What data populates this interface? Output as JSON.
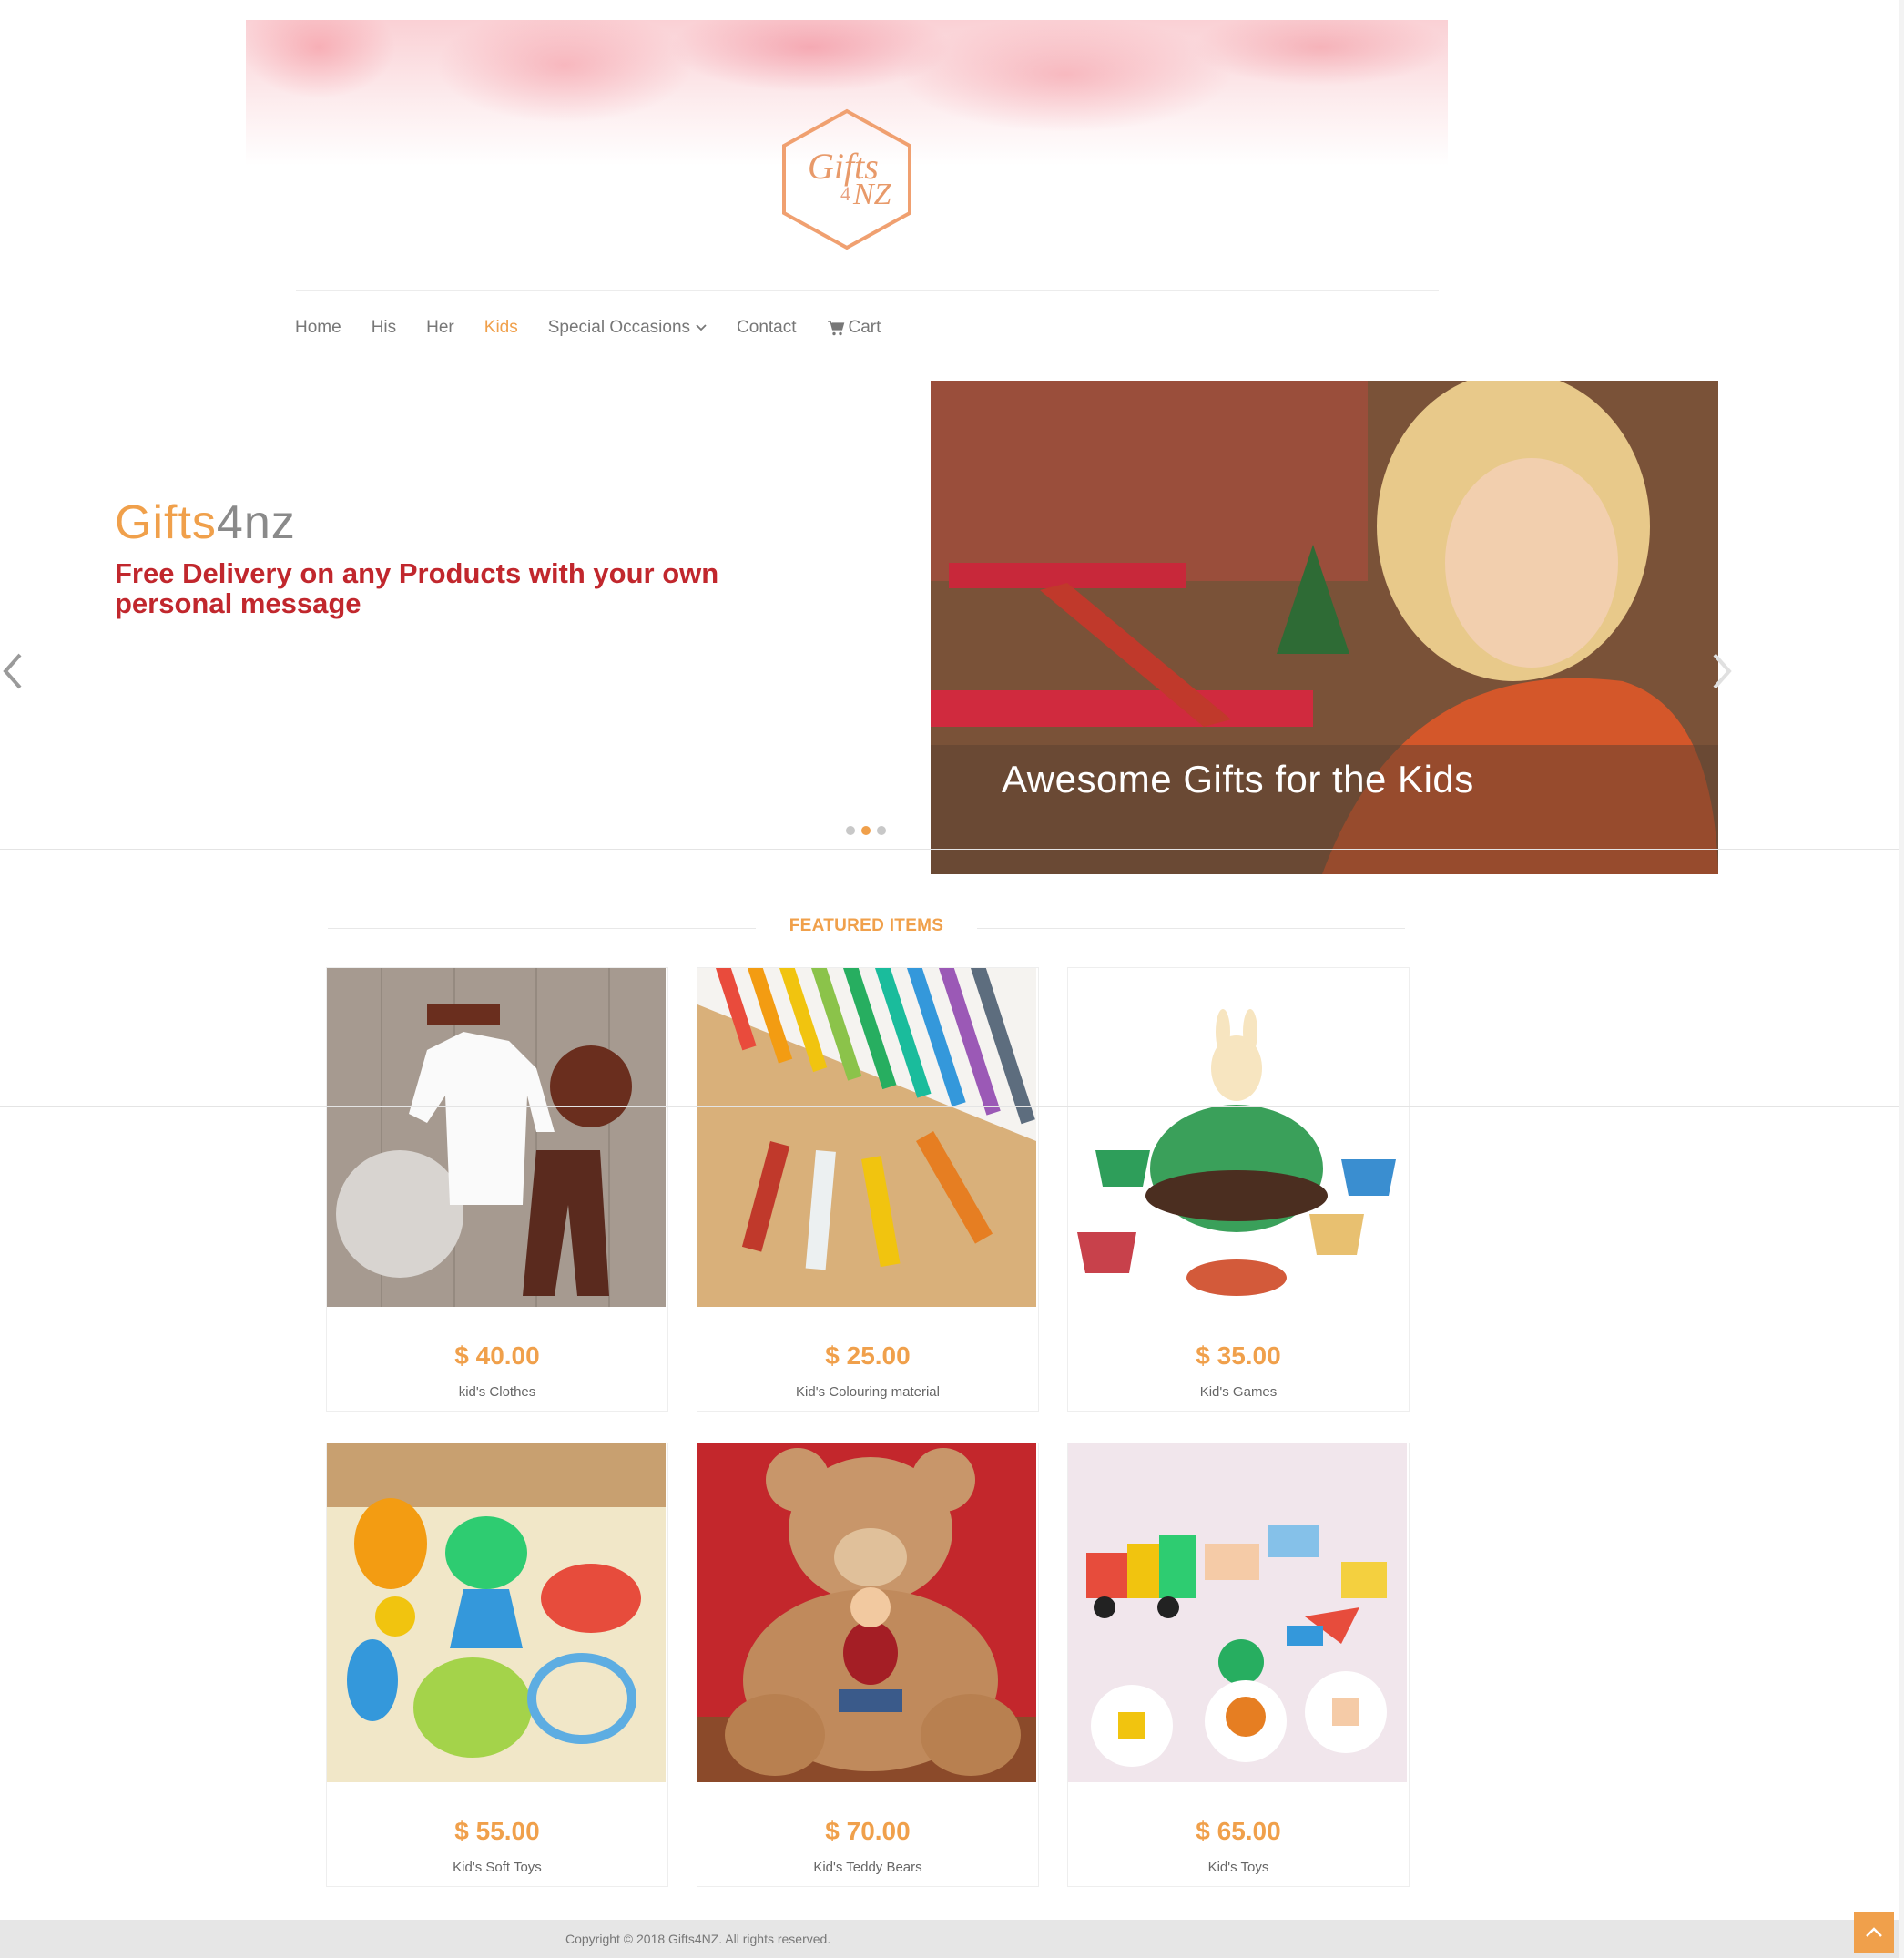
{
  "brand": {
    "logo_line1": "Gifts",
    "logo_line2": "4",
    "logo_line3": "NZ"
  },
  "nav": {
    "items": [
      {
        "label": "Home"
      },
      {
        "label": "His"
      },
      {
        "label": "Her"
      },
      {
        "label": "Kids",
        "active": true
      },
      {
        "label": "Special Occasions",
        "icon": "chevron-down-icon"
      },
      {
        "label": "Contact"
      },
      {
        "label": "Cart",
        "icon": "shopping-cart-icon"
      }
    ]
  },
  "hero": {
    "brand_part1": "Gifts",
    "brand_part2": "4nz",
    "message": "Free Delivery on any Products with your own personal message",
    "caption": "Awesome Gifts for the Kids",
    "slides_total": 3,
    "active_slide": 2
  },
  "featured": {
    "title": "FEATURED ITEMS",
    "items": [
      {
        "price": "$ 40.00",
        "name": "kid's Clothes"
      },
      {
        "price": "$ 25.00",
        "name": "Kid's Colouring material"
      },
      {
        "price": "$ 35.00",
        "name": "Kid's Games"
      },
      {
        "price": "$ 55.00",
        "name": "Kid's Soft Toys"
      },
      {
        "price": "$ 70.00",
        "name": "Kid's Teddy Bears"
      },
      {
        "price": "$ 65.00",
        "name": "Kid's Toys"
      }
    ]
  },
  "footer": {
    "copyright": "Copyright © 2018 Gifts4NZ. All rights reserved."
  },
  "colors": {
    "accent": "#f0a04b",
    "message_red": "#c1272d",
    "text_gray": "#777777"
  }
}
